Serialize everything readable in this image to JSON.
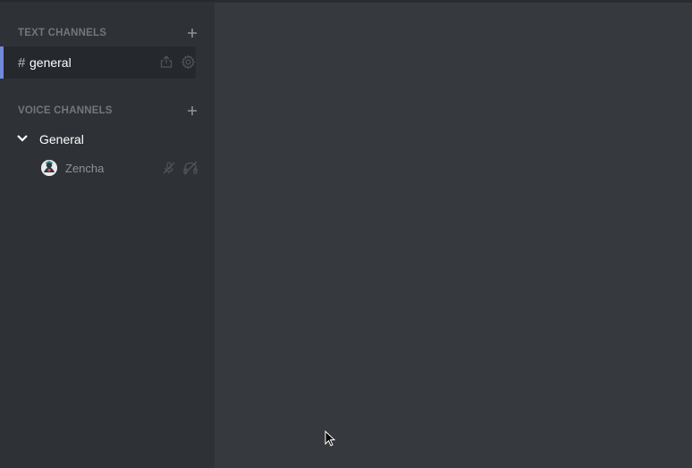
{
  "sidebar": {
    "text_category": {
      "label": "TEXT CHANNELS",
      "add_icon": "plus-icon"
    },
    "text_channels": [
      {
        "prefix": "#",
        "name": "general",
        "active": true,
        "actions": [
          "invite-icon",
          "gear-icon"
        ]
      }
    ],
    "voice_category": {
      "label": "VOICE CHANNELS",
      "add_icon": "plus-icon"
    },
    "voice_channels": [
      {
        "name": "General",
        "expanded": true,
        "users": [
          {
            "name": "Zencha",
            "status_icons": [
              "mic-muted-icon",
              "headphones-deafened-icon"
            ]
          }
        ]
      }
    ]
  },
  "colors": {
    "sidebar_bg": "#2e3136",
    "main_bg": "#36393e",
    "active_channel_bg": "#25282c",
    "accent": "#7289da",
    "category_text": "#72767d",
    "icon_muted": "#4f545c"
  }
}
